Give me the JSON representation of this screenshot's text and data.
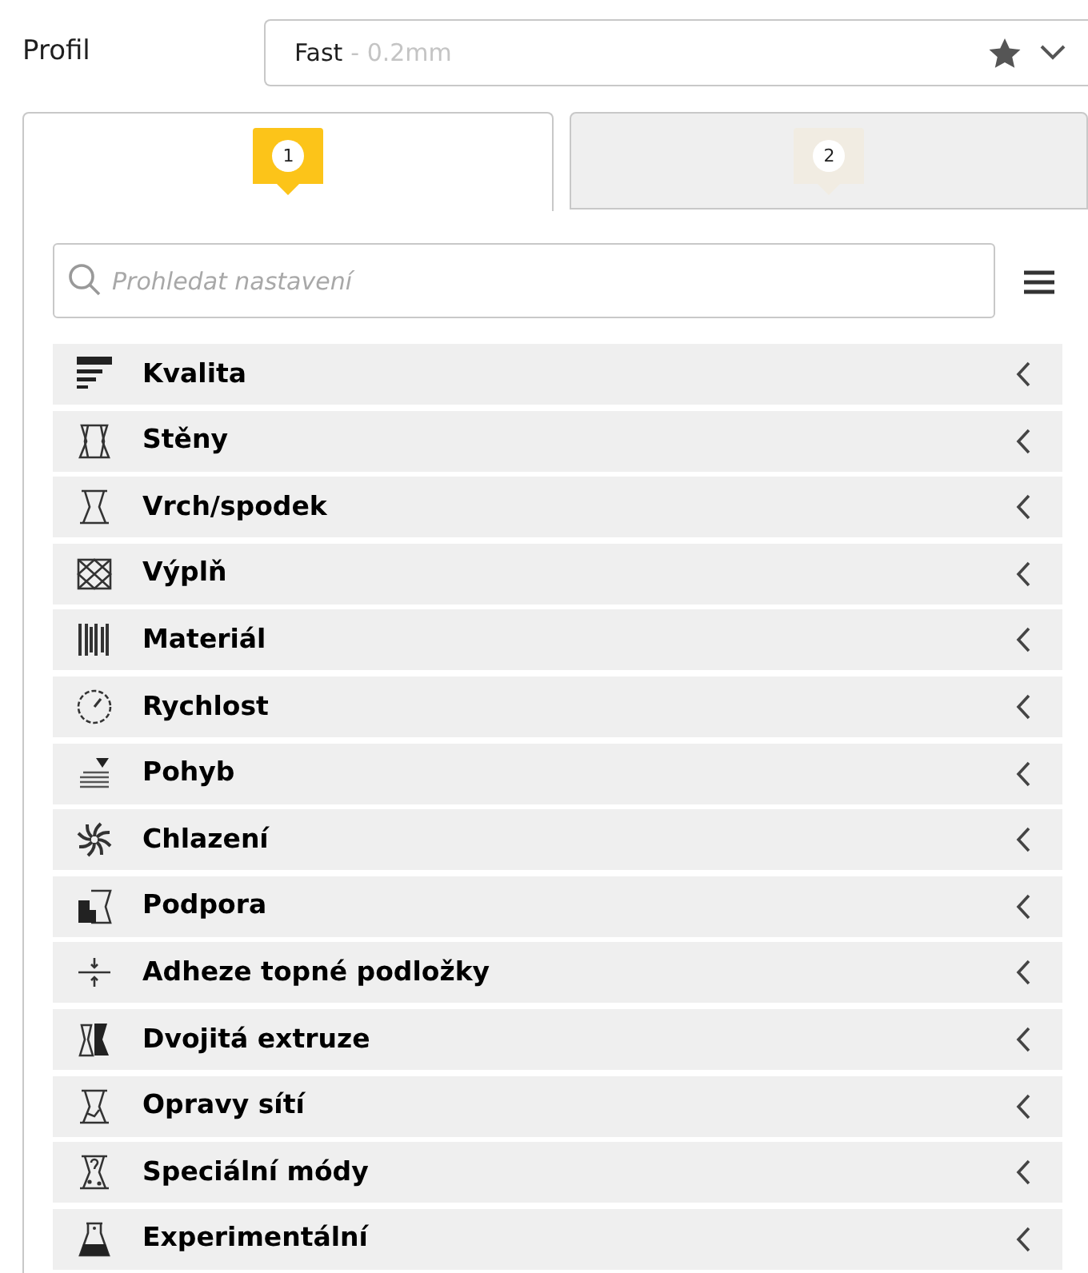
{
  "profile": {
    "label": "Profil",
    "name": "Fast",
    "detail": "- 0.2mm"
  },
  "tabs": [
    {
      "label": "1",
      "selected": true
    },
    {
      "label": "2",
      "selected": false
    }
  ],
  "search": {
    "placeholder": "Prohledat nastavení"
  },
  "categories": [
    {
      "label": "Kvalita"
    },
    {
      "label": "Stěny"
    },
    {
      "label": "Vrch/spodek"
    },
    {
      "label": "Výplň"
    },
    {
      "label": "Materiál"
    },
    {
      "label": "Rychlost"
    },
    {
      "label": "Pohyb"
    },
    {
      "label": "Chlazení"
    },
    {
      "label": "Podpora"
    },
    {
      "label": "Adheze topné podložky"
    },
    {
      "label": "Dvojitá extruze"
    },
    {
      "label": "Opravy sítí"
    },
    {
      "label": "Speciální módy"
    },
    {
      "label": "Experimentální"
    }
  ]
}
